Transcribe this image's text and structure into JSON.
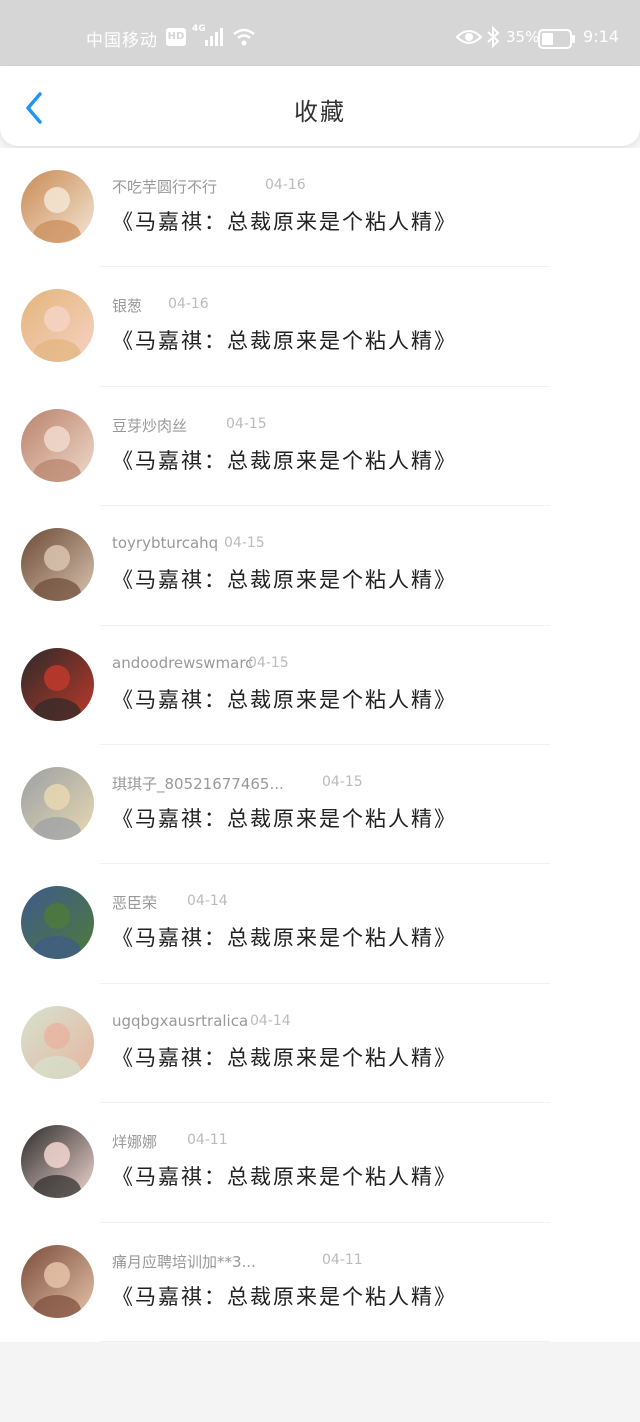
{
  "status_bar": {
    "carrier": "中国移动",
    "hd": "HD",
    "network": "4G",
    "battery_percent": "35%",
    "time": "9:14"
  },
  "nav": {
    "title": "收藏"
  },
  "favorites": [
    {
      "user": "不吃芋圆行不行",
      "date": "04-16",
      "title": "《马嘉祺：总裁原来是个粘人精》",
      "avatar_colors": [
        "#c98a55",
        "#f3e6d3"
      ]
    },
    {
      "user": "银葱",
      "date": "04-16",
      "title": "《马嘉祺：总裁原来是个粘人精》",
      "avatar_colors": [
        "#e3b47a",
        "#f6d3c4"
      ]
    },
    {
      "user": "豆芽炒肉丝",
      "date": "04-15",
      "title": "《马嘉祺：总裁原来是个粘人精》",
      "avatar_colors": [
        "#b8826a",
        "#f1d9cc"
      ]
    },
    {
      "user": "toyrybturcahq",
      "date": "04-15",
      "title": "《马嘉祺：总裁原来是个粘人精》",
      "avatar_colors": [
        "#6b4a36",
        "#d9c4b0"
      ]
    },
    {
      "user": "andoodrewswmarc",
      "date": "04-15",
      "title": "《马嘉祺：总裁原来是个粘人精》",
      "avatar_colors": [
        "#2a2a2a",
        "#c0392b"
      ]
    },
    {
      "user": "琪琪子_80521677465...",
      "date": "04-15",
      "title": "《马嘉祺：总裁原来是个粘人精》",
      "avatar_colors": [
        "#9aa0a6",
        "#e8d8b0"
      ]
    },
    {
      "user": "恶臣荣",
      "date": "04-14",
      "title": "《马嘉祺：总裁原来是个粘人精》",
      "avatar_colors": [
        "#3d5a8c",
        "#4f7a3a"
      ]
    },
    {
      "user": "ugqbgxausrtralica",
      "date": "04-14",
      "title": "《马嘉祺：总裁原来是个粘人精》",
      "avatar_colors": [
        "#d4e3cf",
        "#e7b5a0"
      ]
    },
    {
      "user": "烊娜娜",
      "date": "04-11",
      "title": "《马嘉祺：总裁原来是个粘人精》",
      "avatar_colors": [
        "#2b2b2b",
        "#f2d6cf"
      ]
    },
    {
      "user": "痛月应聘培训加**3...",
      "date": "04-11",
      "title": "《马嘉祺：总裁原来是个粘人精》",
      "avatar_colors": [
        "#7a4c3a",
        "#e5c3a8"
      ]
    }
  ],
  "colors": {
    "accent": "#2196f3",
    "status_bar_bg": "#d6d6d6"
  }
}
